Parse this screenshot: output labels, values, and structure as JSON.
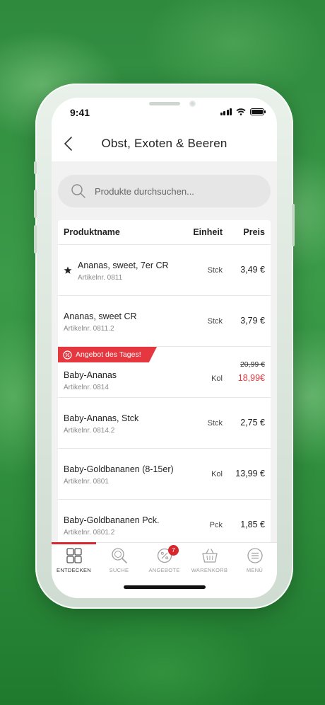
{
  "status_bar": {
    "time": "9:41"
  },
  "header": {
    "title": "Obst, Exoten & Beeren",
    "back_icon": "chevron-left-icon"
  },
  "search": {
    "placeholder": "Produkte durchsuchen...",
    "icon": "search-icon"
  },
  "table": {
    "columns": {
      "name": "Produktname",
      "unit": "Einheit",
      "price": "Preis"
    },
    "rows": [
      {
        "name": "Ananas, sweet, 7er CR",
        "sku": "Artikelnr. 0811",
        "unit": "Stck",
        "price": "3,49 €",
        "favorite": true
      },
      {
        "name": "Ananas, sweet CR",
        "sku": "Artikelnr. 0811.2",
        "unit": "Stck",
        "price": "3,79 €"
      },
      {
        "name": "Baby-Ananas",
        "sku": "Artikelnr. 0814",
        "unit": "Kol",
        "price_old": "20,99 €",
        "price": "18,99€",
        "badge": "Angebot des Tages!"
      },
      {
        "name": "Baby-Ananas, Stck",
        "sku": "Artikelnr. 0814.2",
        "unit": "Stck",
        "price": "2,75 €"
      },
      {
        "name": "Baby-Goldbananen (8-15er)",
        "sku": "Artikelnr. 0801",
        "unit": "Kol",
        "price": "13,99 €"
      },
      {
        "name": "Baby-Goldbananen Pck.",
        "sku": "Artikelnr. 0801.2",
        "unit": "Pck",
        "price": "1,85 €"
      }
    ]
  },
  "tabbar": {
    "tabs": [
      {
        "label": "ENTDECKEN",
        "icon": "grid-icon",
        "active": true
      },
      {
        "label": "SUCHE",
        "icon": "magnifier-icon"
      },
      {
        "label": "ANGEBOTE",
        "icon": "offer-tag-icon",
        "badge": "7"
      },
      {
        "label": "WARENKORB",
        "icon": "basket-icon"
      },
      {
        "label": "MENÜ",
        "icon": "menu-icon"
      }
    ]
  },
  "colors": {
    "accent": "#d8282f",
    "offer": "#e5373f",
    "background": "#2f8a3e"
  }
}
